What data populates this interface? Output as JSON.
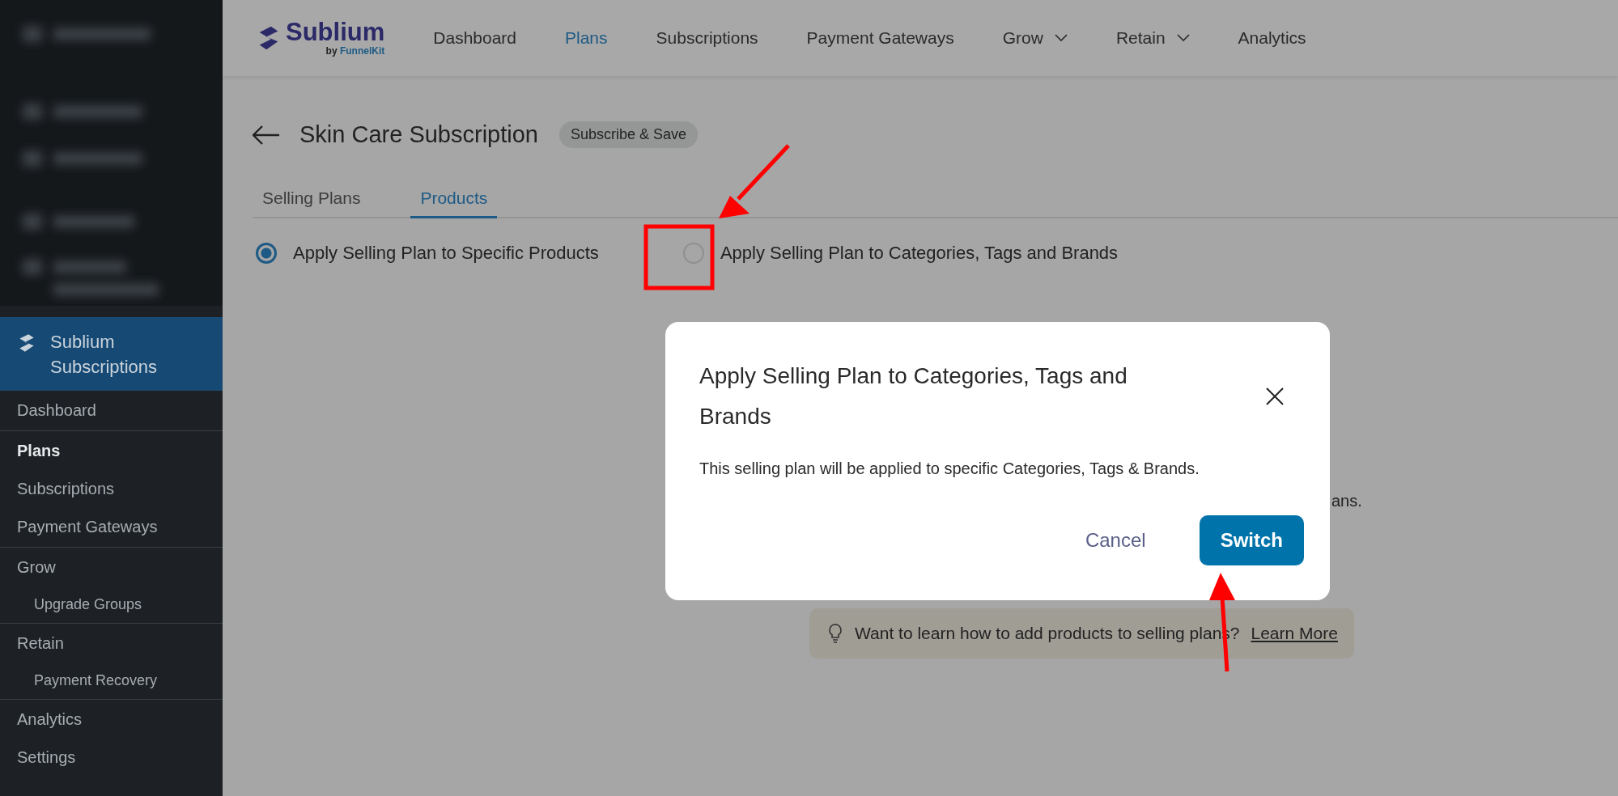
{
  "sidebar": {
    "brand": "Sublium Subscriptions",
    "groups": [
      {
        "items": [
          {
            "label": "Dashboard",
            "selected": false
          }
        ]
      },
      {
        "items": [
          {
            "label": "Plans",
            "selected": true
          },
          {
            "label": "Subscriptions",
            "selected": false
          },
          {
            "label": "Payment Gateways",
            "selected": false
          }
        ]
      },
      {
        "items": [
          {
            "label": "Grow",
            "selected": false,
            "children": [
              {
                "label": "Upgrade Groups",
                "selected": false
              }
            ]
          }
        ]
      },
      {
        "items": [
          {
            "label": "Retain",
            "selected": false,
            "children": [
              {
                "label": "Payment Recovery",
                "selected": false
              }
            ]
          }
        ]
      },
      {
        "items": [
          {
            "label": "Analytics",
            "selected": false
          },
          {
            "label": "Settings",
            "selected": false
          }
        ]
      }
    ]
  },
  "header": {
    "logo": {
      "name": "Sublium",
      "byline": "by ",
      "byline_brand": "FunnelKit"
    },
    "nav": [
      {
        "label": "Dashboard",
        "selected": false,
        "dropdown": false
      },
      {
        "label": "Plans",
        "selected": true,
        "dropdown": false
      },
      {
        "label": "Subscriptions",
        "selected": false,
        "dropdown": false
      },
      {
        "label": "Payment Gateways",
        "selected": false,
        "dropdown": false
      },
      {
        "label": "Grow",
        "selected": false,
        "dropdown": true
      },
      {
        "label": "Retain",
        "selected": false,
        "dropdown": true
      },
      {
        "label": "Analytics",
        "selected": false,
        "dropdown": false
      }
    ]
  },
  "page": {
    "title": "Skin Care Subscription",
    "badge": "Subscribe & Save",
    "tabs": [
      {
        "label": "Selling Plans",
        "selected": false
      },
      {
        "label": "Products",
        "selected": true
      }
    ],
    "options": [
      {
        "label": "Apply Selling Plan to Specific Products",
        "selected": true
      },
      {
        "label": "Apply Selling Plan to Categories, Tags and Brands",
        "selected": false
      }
    ],
    "covered_text": "ans.",
    "tip": {
      "text": "Want to learn how to add products to selling plans?",
      "link": "Learn More"
    }
  },
  "dialog": {
    "title": "Apply Selling Plan to Categories, Tags and Brands",
    "body": "This selling plan will be applied to specific Categories, Tags & Brands.",
    "buttons": [
      {
        "label": "Cancel",
        "kind": "secondary"
      },
      {
        "label": "Switch",
        "kind": "primary"
      }
    ]
  }
}
